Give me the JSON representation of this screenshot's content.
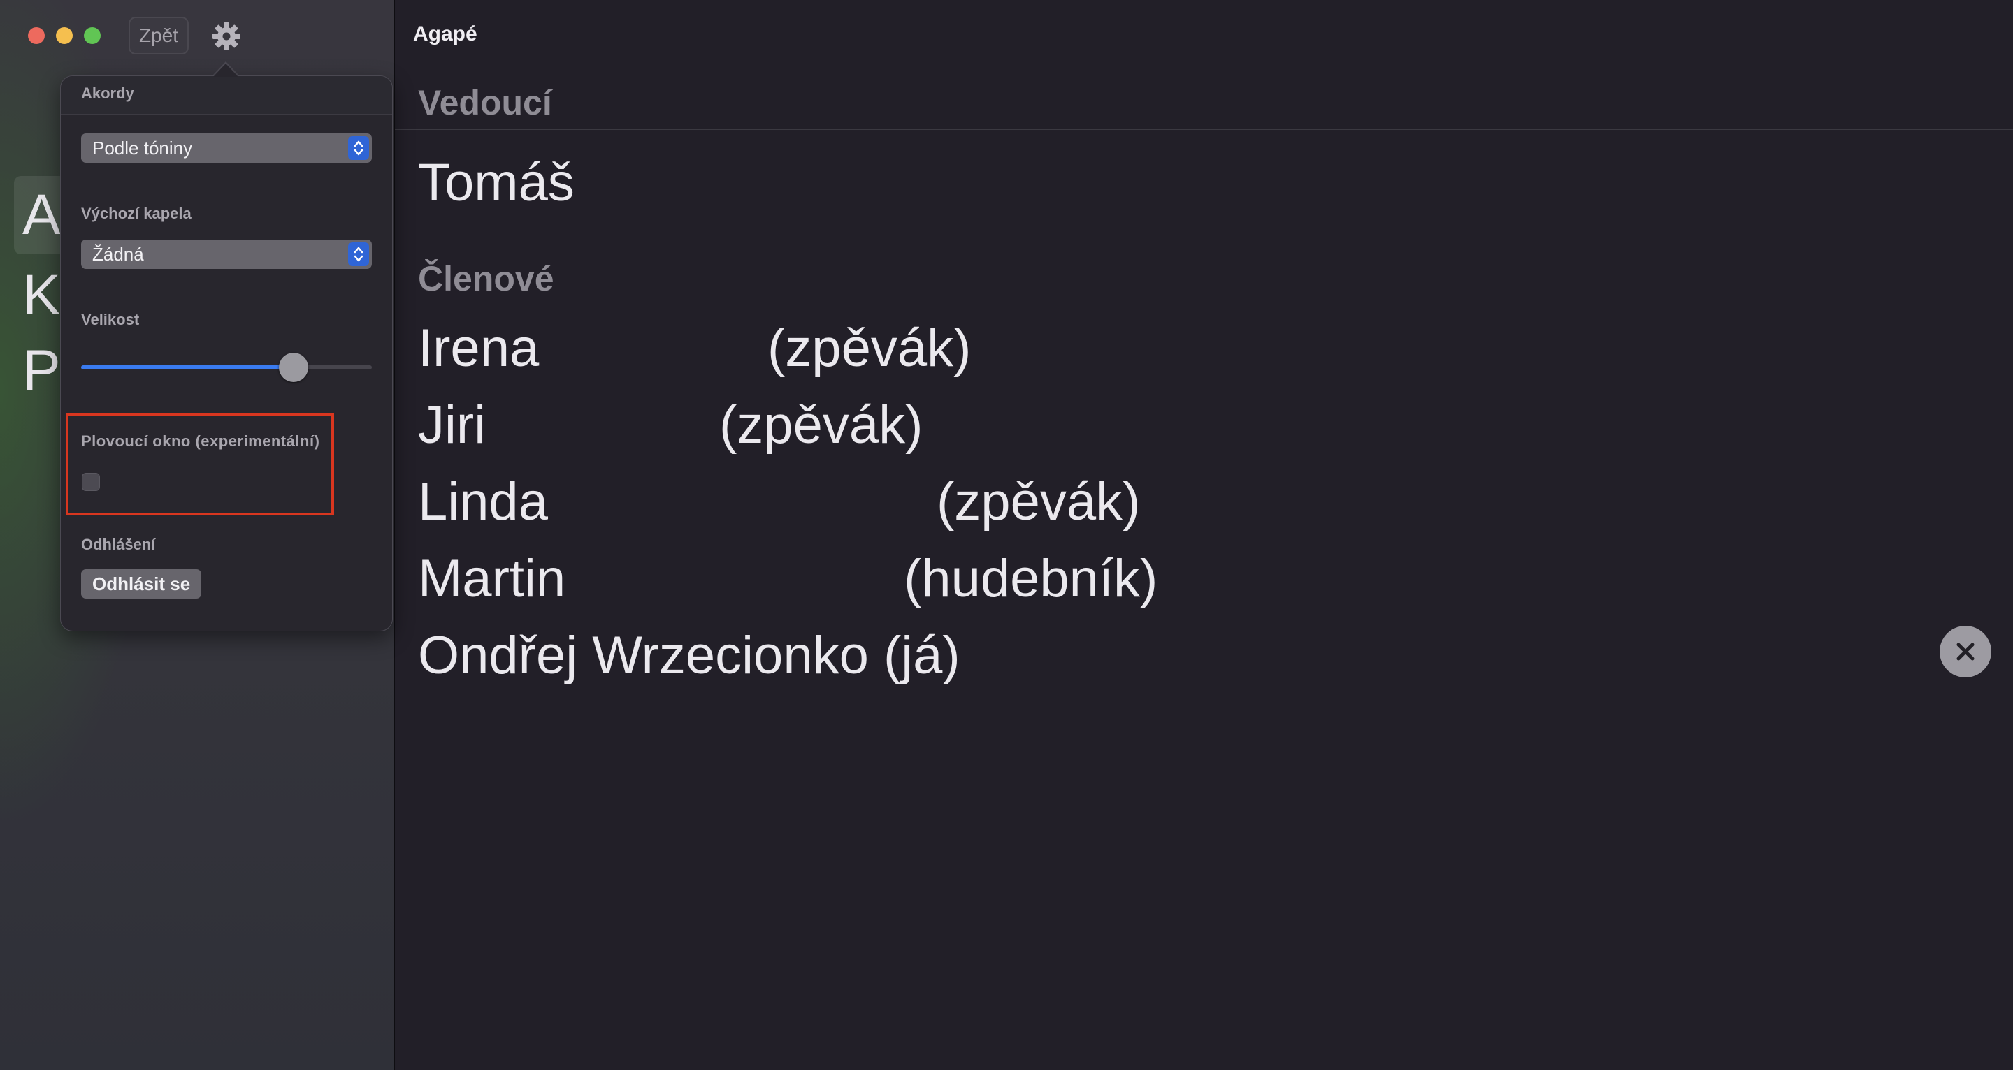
{
  "window": {
    "back_label": "Zpět",
    "settings_icon": "gear-icon"
  },
  "sidebar": {
    "items": [
      {
        "label": "A",
        "selected": true
      },
      {
        "label": "K",
        "selected": false
      },
      {
        "label": "P",
        "selected": false
      }
    ]
  },
  "settings_popover": {
    "chords": {
      "label": "Akordy",
      "value": "Podle tóniny"
    },
    "default_band": {
      "label": "Výchozí kapela",
      "value": "Žádná"
    },
    "size": {
      "label": "Velikost",
      "level": 0.72
    },
    "floating_window": {
      "label": "Plovoucí okno (experimentální)",
      "checked": false
    },
    "logout": {
      "label": "Odhlášení",
      "button": "Odhlásit se"
    }
  },
  "band": {
    "title": "Agapé",
    "leaders_heading": "Vedoucí",
    "leader": "Tomáš",
    "members_heading": "Členové",
    "members": [
      {
        "name": "Irena",
        "role": "(zpěvák)"
      },
      {
        "name": "Jiri",
        "role": "(zpěvák)"
      },
      {
        "name": "Linda",
        "role": "(zpěvák)"
      },
      {
        "name": "Martin",
        "role": "(hudebník)"
      },
      {
        "name": "Ondřej Wrzecionko (já)",
        "role": ""
      }
    ]
  },
  "colors": {
    "accent": "#3a7bf0",
    "highlight_box": "#d9361f",
    "background": "#221f28"
  }
}
